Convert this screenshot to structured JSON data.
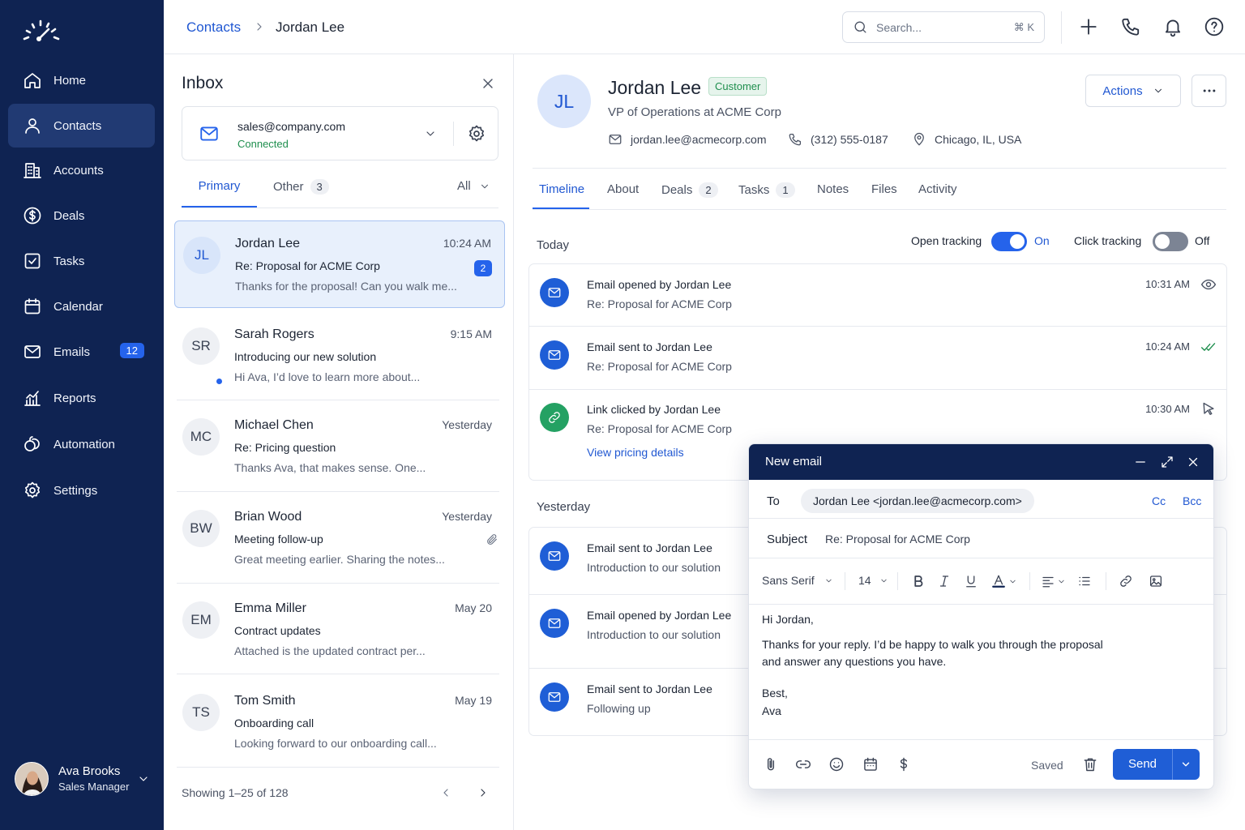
{
  "colors": {
    "sidebar_bg": "#0f2352",
    "accent": "#2563eb",
    "success": "#1f8f4e",
    "toggle_off": "#7c8494"
  },
  "sidebar": {
    "logo": "speedometer-logo",
    "items": [
      {
        "label": "Home",
        "icon": "home-icon"
      },
      {
        "label": "Contacts",
        "icon": "user-icon",
        "active": true
      },
      {
        "label": "Accounts",
        "icon": "building-icon"
      },
      {
        "label": "Deals",
        "icon": "dollar-icon"
      },
      {
        "label": "Tasks",
        "icon": "checkbox-icon"
      },
      {
        "label": "Calendar",
        "icon": "calendar-icon"
      },
      {
        "label": "Emails",
        "icon": "mail-icon",
        "badge": "12"
      },
      {
        "label": "Reports",
        "icon": "chart-icon"
      },
      {
        "label": "Automation",
        "icon": "automation-icon"
      },
      {
        "label": "Settings",
        "icon": "gear-icon"
      }
    ],
    "user": {
      "name": "Ava Brooks",
      "role": "Sales Manager"
    }
  },
  "header": {
    "breadcrumb": {
      "parent": "Contacts",
      "current": "Jordan Lee"
    },
    "search": {
      "placeholder": "Search...",
      "shortcut": "⌘ K"
    }
  },
  "inbox": {
    "title": "Inbox",
    "account": {
      "email": "sales@company.com",
      "status": "Connected"
    },
    "tabs": {
      "primary": "Primary",
      "other": "Other",
      "other_count": "3",
      "filter": "All"
    },
    "messages": [
      {
        "initials": "JL",
        "name": "Jordan Lee",
        "time": "10:24 AM",
        "subject": "Re: Proposal for ACME Corp",
        "preview": "Thanks for the proposal! Can you walk me...",
        "count": "2",
        "selected": true
      },
      {
        "initials": "SR",
        "name": "Sarah Rogers",
        "time": "9:15 AM",
        "subject": "Introducing our new solution",
        "preview": "Hi Ava, I’d love to learn more about...",
        "unread": true
      },
      {
        "initials": "MC",
        "name": "Michael Chen",
        "time": "Yesterday",
        "subject": "Re: Pricing question",
        "preview": "Thanks Ava, that makes sense. One..."
      },
      {
        "initials": "BW",
        "name": "Brian Wood",
        "time": "Yesterday",
        "subject": "Meeting follow-up",
        "preview": "Great meeting earlier. Sharing the notes...",
        "attachment": true
      },
      {
        "initials": "EM",
        "name": "Emma Miller",
        "time": "May 20",
        "subject": "Contract updates",
        "preview": "Attached is the updated contract per..."
      },
      {
        "initials": "TS",
        "name": "Tom Smith",
        "time": "May 19",
        "subject": "Onboarding call",
        "preview": "Looking forward to our onboarding call..."
      }
    ],
    "footer": "Showing 1–25 of 128"
  },
  "contact": {
    "initials": "JL",
    "name": "Jordan Lee",
    "badge": "Customer",
    "title": "VP of Operations at ACME Corp",
    "email": "jordan.lee@acmecorp.com",
    "phone": "(312) 555-0187",
    "location": "Chicago, IL, USA",
    "actions_label": "Actions",
    "tabs": [
      {
        "label": "Timeline"
      },
      {
        "label": "About"
      },
      {
        "label": "Deals",
        "count": "2"
      },
      {
        "label": "Tasks",
        "count": "1"
      },
      {
        "label": "Notes"
      },
      {
        "label": "Files"
      },
      {
        "label": "Activity"
      }
    ]
  },
  "timeline": {
    "today_label": "Today",
    "yesterday_label": "Yesterday",
    "open_tracking": {
      "label": "Open tracking",
      "state": "On",
      "enabled": true
    },
    "click_tracking": {
      "label": "Click tracking",
      "state": "Off",
      "enabled": false
    },
    "today": [
      {
        "title": "Email opened by Jordan Lee",
        "subtitle": "Re: Proposal for ACME Corp",
        "time": "10:31 AM",
        "status_icon": "eye-icon"
      },
      {
        "title": "Email sent to Jordan Lee",
        "subtitle": "Re: Proposal for ACME Corp",
        "time": "10:24 AM",
        "status_icon": "double-check-icon"
      },
      {
        "title": "Link clicked by Jordan Lee",
        "subtitle": "Re: Proposal for ACME Corp",
        "time": "10:30 AM",
        "status_icon": "cursor-icon",
        "link": "View pricing details"
      }
    ],
    "yesterday": [
      {
        "title": "Email sent to Jordan Lee",
        "subtitle": "Introduction to our solution"
      },
      {
        "title": "Email opened by Jordan Lee",
        "subtitle": "Introduction to our solution"
      },
      {
        "title": "Email sent to Jordan Lee",
        "subtitle": "Following up"
      }
    ]
  },
  "compose": {
    "title": "New email",
    "to_label": "To",
    "to": "Jordan Lee <jordan.lee@acmecorp.com>",
    "cc": "Cc",
    "bcc": "Bcc",
    "subject_label": "Subject",
    "subject": "Re: Proposal for ACME Corp",
    "font": "Sans Serif",
    "font_size": "14",
    "body": [
      "Hi Jordan,",
      "Thanks for your reply. I’d be happy to walk you through the proposal",
      "and answer any questions you have.",
      "Best,",
      "Ava"
    ],
    "saved": "Saved",
    "send": "Send"
  }
}
